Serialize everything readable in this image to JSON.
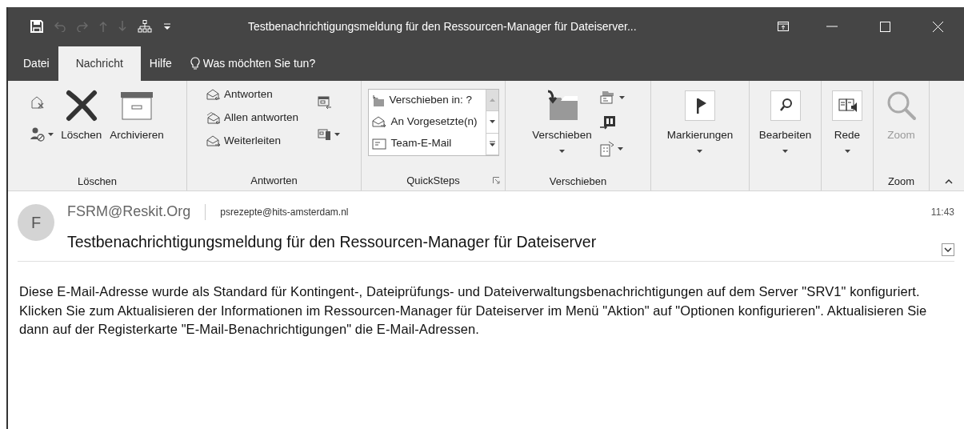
{
  "window": {
    "title": "Testbenachrichtigungsmeldung für den Ressourcen-Manager für Dateiserver...",
    "quick_access": [
      {
        "disabled": false
      },
      {
        "disabled": true
      },
      {
        "disabled": true
      },
      {
        "disabled": true
      },
      {
        "disabled": true
      },
      {
        "disabled": false
      },
      {
        "disabled": false
      }
    ]
  },
  "tabs": [
    {
      "label": "Datei",
      "selected": false
    },
    {
      "label": "Nachricht",
      "selected": true
    },
    {
      "label": "Hilfe",
      "selected": false
    }
  ],
  "tell_me": {
    "placeholder": "Was möchten Sie tun?"
  },
  "ribbon": {
    "groups": [
      {
        "label": "Löschen",
        "items": [
          {
            "kind": "icon"
          },
          {
            "kind": "icon-dropdown"
          },
          {
            "kind": "large",
            "label": "Löschen",
            "dropdown": false,
            "disabled": false
          },
          {
            "kind": "large",
            "label": "Archivieren",
            "dropdown": false,
            "disabled": false
          }
        ]
      },
      {
        "label": "Antworten",
        "items": [
          {
            "kind": "small",
            "label": "Antworten"
          },
          {
            "kind": "small",
            "label": "Allen antworten"
          },
          {
            "kind": "small",
            "label": "Weiterleiten"
          },
          {
            "kind": "icon"
          },
          {
            "kind": "icon-dropdown"
          }
        ]
      },
      {
        "label": "QuickSteps",
        "items": [
          {
            "kind": "gallery-entry",
            "label": "Verschieben in: ?"
          },
          {
            "kind": "gallery-entry",
            "label": "An Vorgesetzte(n)"
          },
          {
            "kind": "gallery-entry",
            "label": "Team-E-Mail"
          }
        ]
      },
      {
        "label": "Verschieben",
        "items": [
          {
            "kind": "large",
            "label": "Verschieben",
            "dropdown": true,
            "disabled": false
          },
          {
            "kind": "icon-dropdown"
          },
          {
            "kind": "icon"
          },
          {
            "kind": "icon-dropdown"
          }
        ]
      },
      {
        "items": [
          {
            "kind": "large",
            "label": "Markierungen",
            "dropdown": true,
            "disabled": false
          }
        ]
      },
      {
        "items": [
          {
            "kind": "large",
            "label": "Bearbeiten",
            "dropdown": true,
            "disabled": false
          }
        ]
      },
      {
        "items": [
          {
            "kind": "large",
            "label": "Rede",
            "dropdown": true,
            "disabled": false
          }
        ]
      },
      {
        "label": "Zoom",
        "items": [
          {
            "kind": "large",
            "label": "Zoom",
            "dropdown": false,
            "disabled": true
          }
        ]
      }
    ]
  },
  "message": {
    "avatar": "F",
    "sender": "FSRM@Reskit.Org",
    "recipient": "psrezepte@hits-amsterdam.nl",
    "time": "11:43",
    "subject": "Testbenachrichtigungsmeldung für den Ressourcen-Manager für Dateiserver",
    "body": "Diese E-Mail-Adresse wurde als Standard für Kontingent-, Dateiprüfungs- und Dateiverwaltungsbenachrichtigungen auf dem Server \"SRV1\" konfiguriert. Klicken Sie zum Aktualisieren der Informationen im Ressourcen-Manager für Dateiserver im Menü \"Aktion\" auf \"Optionen konfigurieren\". Aktualisieren Sie dann auf der Registerkarte \"E-Mail-Benachrichtigungen\" die E-Mail-Adressen."
  }
}
